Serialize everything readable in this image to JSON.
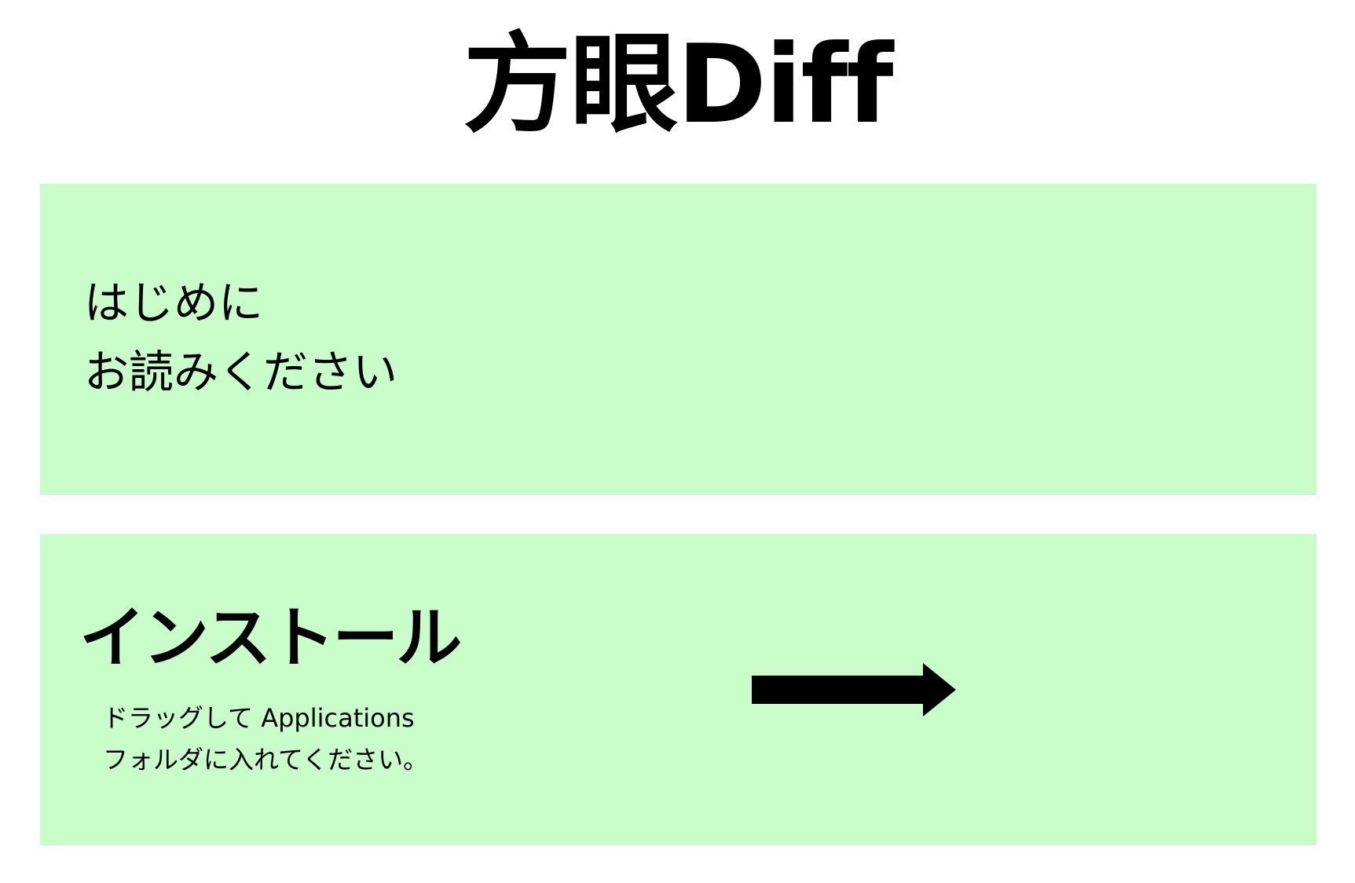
{
  "title": "方眼Diff",
  "readme_panel": {
    "line1": "はじめに",
    "line2": "お読みください"
  },
  "install_panel": {
    "heading": "インストール",
    "instruction_line1": "ドラッグして Applications",
    "instruction_line2": "フォルダに入れてください。"
  },
  "colors": {
    "panel_background": "#c8fcc8",
    "text": "#000000",
    "page_background": "#ffffff"
  },
  "icons": {
    "drag_arrow": "right-arrow-icon"
  }
}
